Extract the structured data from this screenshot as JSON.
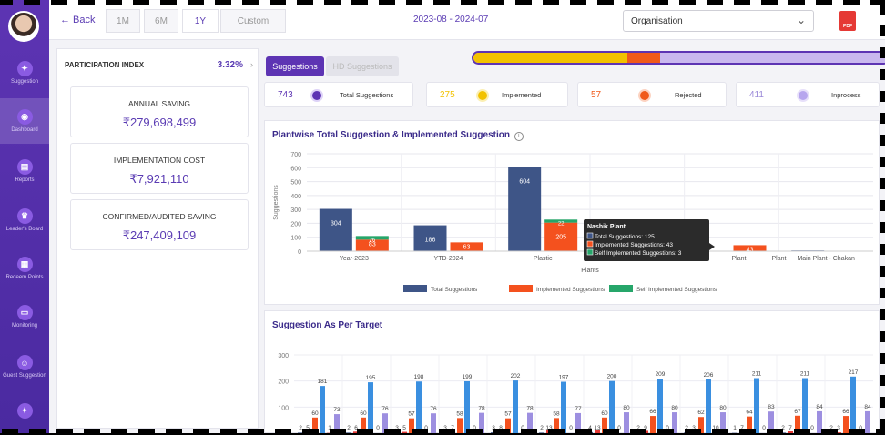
{
  "topbar": {
    "back_label": "← Back",
    "ranges": [
      "1M",
      "6M",
      "1Y",
      "Custom"
    ],
    "active_range": "1Y",
    "date_range": "2023-08 - 2024-07",
    "organisation": "Organisation",
    "pdf_label": "PDF"
  },
  "sidebar": {
    "items": [
      {
        "label": "Suggestion",
        "icon": "lightbulb-icon"
      },
      {
        "label": "Dashboard",
        "icon": "dashboard-icon"
      },
      {
        "label": "Reports",
        "icon": "report-icon"
      },
      {
        "label": "Leader's Board",
        "icon": "trophy-icon"
      },
      {
        "label": "Redeem Points",
        "icon": "gift-icon"
      },
      {
        "label": "Monitoring",
        "icon": "monitor-icon"
      },
      {
        "label": "Guest Suggestion",
        "icon": "guest-icon"
      },
      {
        "label": "",
        "icon": "lightbulb-icon"
      }
    ]
  },
  "left_panel": {
    "participation_label": "PARTICIPATION INDEX",
    "participation_value": "3.32%",
    "kpis": [
      {
        "title": "ANNUAL SAVING",
        "value": "₹279,698,499"
      },
      {
        "title": "IMPLEMENTATION COST",
        "value": "₹7,921,110"
      },
      {
        "title": "CONFIRMED/AUDITED SAVING",
        "value": "₹247,409,109"
      }
    ]
  },
  "tabs": {
    "suggestions": "Suggestions",
    "hd": "HD Suggestions"
  },
  "progress": {
    "implemented": 0.37,
    "rejected": 0.08,
    "inprocess": 0.55
  },
  "stats": [
    {
      "value": "743",
      "label": "Total Suggestions",
      "color": "#5d34b3"
    },
    {
      "value": "275",
      "label": "Implemented",
      "color": "#f2c200"
    },
    {
      "value": "57",
      "label": "Rejected",
      "color": "#f05a1a"
    },
    {
      "value": "411",
      "label": "Inprocess",
      "color": "#b7a6ee"
    }
  ],
  "colors": {
    "purple": "#5d34b3",
    "navy": "#3e5587",
    "orange": "#f4511e",
    "green": "#26a66a",
    "blue": "#3a8fe0",
    "red": "#e53935"
  },
  "chart1_title": "Plantwise Total Suggestion & Implemented Suggestion",
  "chart2_title": "Suggestion As Per Target",
  "tooltip": {
    "title": "Nashik Plant",
    "lines": [
      "Total Suggestions: 125",
      "Implemented Suggestions: 43",
      "Self Implemented Suggestions: 3"
    ]
  },
  "chart_data": [
    {
      "type": "bar",
      "title": "Plantwise Total Suggestion & Implemented Suggestion",
      "xlabel": "Plants",
      "ylabel": "Suggestions",
      "ylim": [
        0,
        700
      ],
      "yticks": [
        0,
        100,
        200,
        300,
        400,
        500,
        600,
        700
      ],
      "categories": [
        "Year-2023",
        "YTD-2024",
        "Plastic",
        "Nashik Plant",
        "Plant",
        "Main Plant - Chakan"
      ],
      "series": [
        {
          "name": "Total Suggestions",
          "values": [
            304,
            186,
            604,
            125,
            0,
            5
          ]
        },
        {
          "name": "Implemented Suggestions",
          "values": [
            83,
            63,
            205,
            43,
            43,
            0
          ]
        },
        {
          "name": "Self Implemented Suggestions",
          "values": [
            26,
            0,
            22,
            3,
            0,
            0
          ]
        }
      ],
      "bar_labels": [
        [
          "304",
          "186",
          "604",
          "",
          "",
          ""
        ],
        [
          "83",
          "63",
          "205",
          "",
          "43",
          ""
        ],
        [
          "26",
          "",
          "22",
          "",
          "",
          ""
        ]
      ],
      "grid": true,
      "legend": "bottom"
    },
    {
      "type": "bar",
      "title": "Suggestion As Per Target",
      "ylim": [
        0,
        300
      ],
      "yticks": [
        100,
        200,
        300
      ],
      "groups": 12,
      "series": [
        {
          "values": [
            2,
            2,
            3,
            3,
            3,
            2,
            4,
            2,
            2,
            1,
            2,
            2
          ]
        },
        {
          "values": [
            5,
            6,
            5,
            7,
            8,
            13,
            13,
            9,
            3,
            7,
            7,
            3
          ]
        },
        {
          "values": [
            60,
            60,
            57,
            58,
            57,
            58,
            60,
            66,
            62,
            64,
            67,
            66
          ]
        },
        {
          "values": [
            181,
            195,
            198,
            199,
            202,
            197,
            200,
            209,
            206,
            211,
            211,
            217
          ]
        },
        {
          "values": [
            1,
            0,
            0,
            0,
            0,
            0,
            0,
            0,
            10,
            0,
            0,
            0
          ]
        },
        {
          "values": [
            73,
            76,
            76,
            78,
            78,
            77,
            80,
            80,
            80,
            83,
            84,
            84
          ]
        }
      ],
      "grid": true
    }
  ]
}
